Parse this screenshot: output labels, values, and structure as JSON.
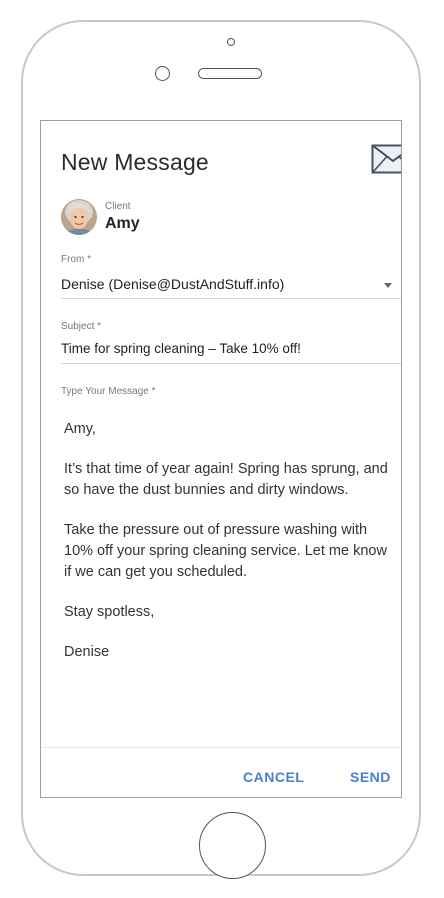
{
  "header": {
    "title": "New Message",
    "mail_icon": "envelope-icon"
  },
  "client": {
    "label": "Client",
    "name": "Amy",
    "avatar_icon": "user-avatar"
  },
  "from": {
    "label": "From *",
    "value": "Denise (Denise@DustAndStuff.info)"
  },
  "subject": {
    "label": "Subject *",
    "value": "Time for spring cleaning – Take 10% off!"
  },
  "message": {
    "label": "Type Your Message *",
    "paragraphs": [
      "Amy,",
      "It’s that time of year again! Spring has sprung, and so have the dust bunnies and dirty windows.",
      "Take the pressure out of pressure washing with 10% off your spring cleaning service. Let me know if we can get you scheduled.",
      "Stay spotless,",
      "Denise"
    ]
  },
  "actions": {
    "cancel": "CANCEL",
    "send": "SEND"
  },
  "colors": {
    "accent": "#4a7fd4",
    "text": "#222222",
    "muted": "#777777"
  }
}
